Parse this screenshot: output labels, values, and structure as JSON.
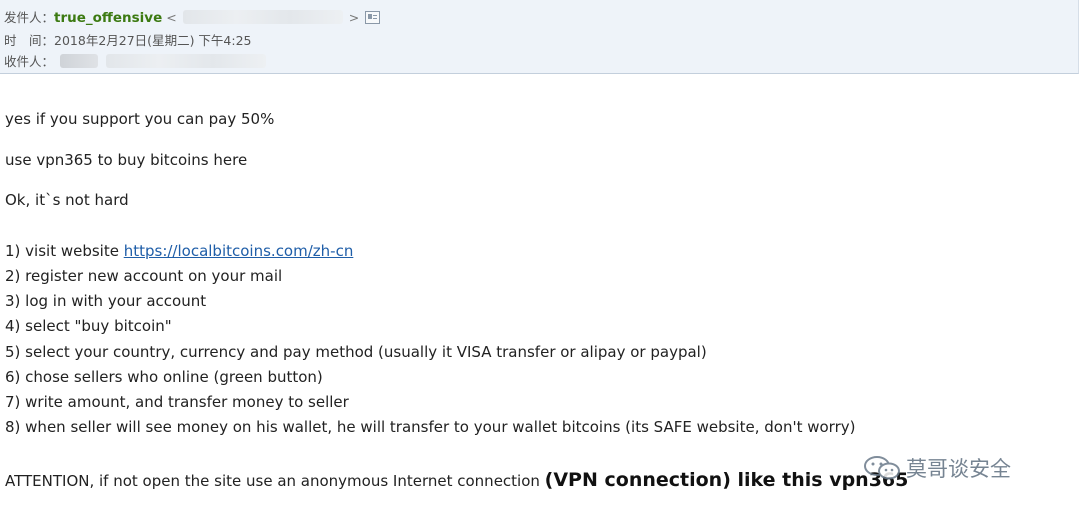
{
  "header": {
    "from_label": "发件人：",
    "sender_name": "true_offensive",
    "lt": "<",
    "gt": ">",
    "time_label": "时　间：",
    "time_value": "2018年2月27日(星期二) 下午4:25",
    "to_label": "收件人："
  },
  "body": {
    "lines": [
      "yes if you support you can pay 50%",
      "use vpn365 to buy bitcoins here",
      "Ok, it`s not hard"
    ],
    "step1_prefix": "1) visit website ",
    "step1_link": "https://localbitcoins.com/zh-cn",
    "steps": [
      "2) register new account on your mail",
      "3) log in with your account",
      "4) select \"buy bitcoin\"",
      "5) select your country, currency and pay method (usually it VISA transfer or alipay or paypal)",
      "6) chose sellers who online (green button)",
      "7) write amount, and transfer money to seller",
      "8) when seller will see money on his wallet, he will transfer to your wallet bitcoins (its SAFE website, don't worry)"
    ],
    "attention_text": "ATTENTION, if not open the site use an anonymous Internet connection ",
    "attention_bold": "(VPN connection) like this vpn365"
  },
  "watermark": {
    "text": "莫哥谈安全",
    "icon": "wechat-icon"
  }
}
